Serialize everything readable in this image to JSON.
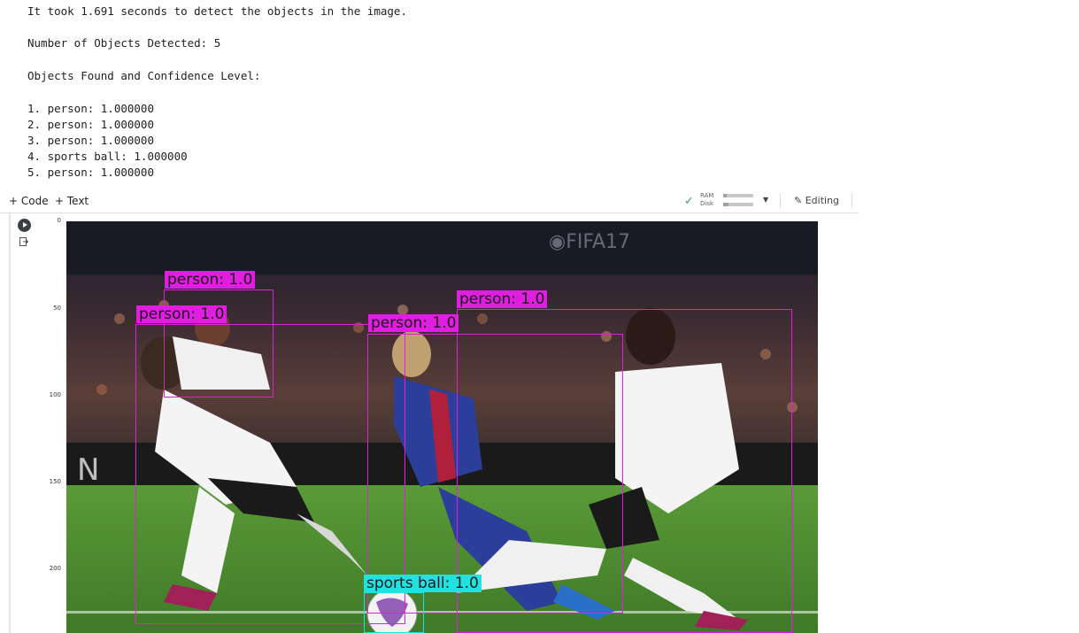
{
  "output": {
    "time_line": "It took 1.691 seconds to detect the objects in the image.",
    "count_line": "Number of Objects Detected: 5",
    "header_line": "Objects Found and Confidence Level:",
    "items": [
      "1. person: 1.000000",
      "2. person: 1.000000",
      "3. person: 1.000000",
      "4. sports ball: 1.000000",
      "5. person: 1.000000"
    ]
  },
  "toolbar": {
    "add_code": "+ Code",
    "add_text": "+ Text",
    "ram_label": "RAM",
    "disk_label": "Disk",
    "ram_usage": 0.12,
    "disk_usage": 0.18,
    "editing_label": "Editing"
  },
  "plot": {
    "y_ticks": [
      "0",
      "50",
      "100",
      "150",
      "200"
    ]
  },
  "detections": [
    {
      "label": "person: 1.0",
      "color": "#e01ee0"
    },
    {
      "label": "person: 1.0",
      "color": "#e01ee0"
    },
    {
      "label": "person: 1.0",
      "color": "#e01ee0"
    },
    {
      "label": "person: 1.0",
      "color": "#e01ee0"
    },
    {
      "label": "sports ball: 1.0",
      "color": "#22e1e1"
    }
  ],
  "colors": {
    "person_box": "#e01ee0",
    "ball_box": "#22e1e1",
    "pitch": "#4c8a2f",
    "home_kit": "#f4f4f4",
    "away_kit": "#2b3f9a"
  },
  "icons": [
    "checkmark-icon",
    "caret-down-icon",
    "pencil-icon",
    "play-icon",
    "output-icon"
  ]
}
